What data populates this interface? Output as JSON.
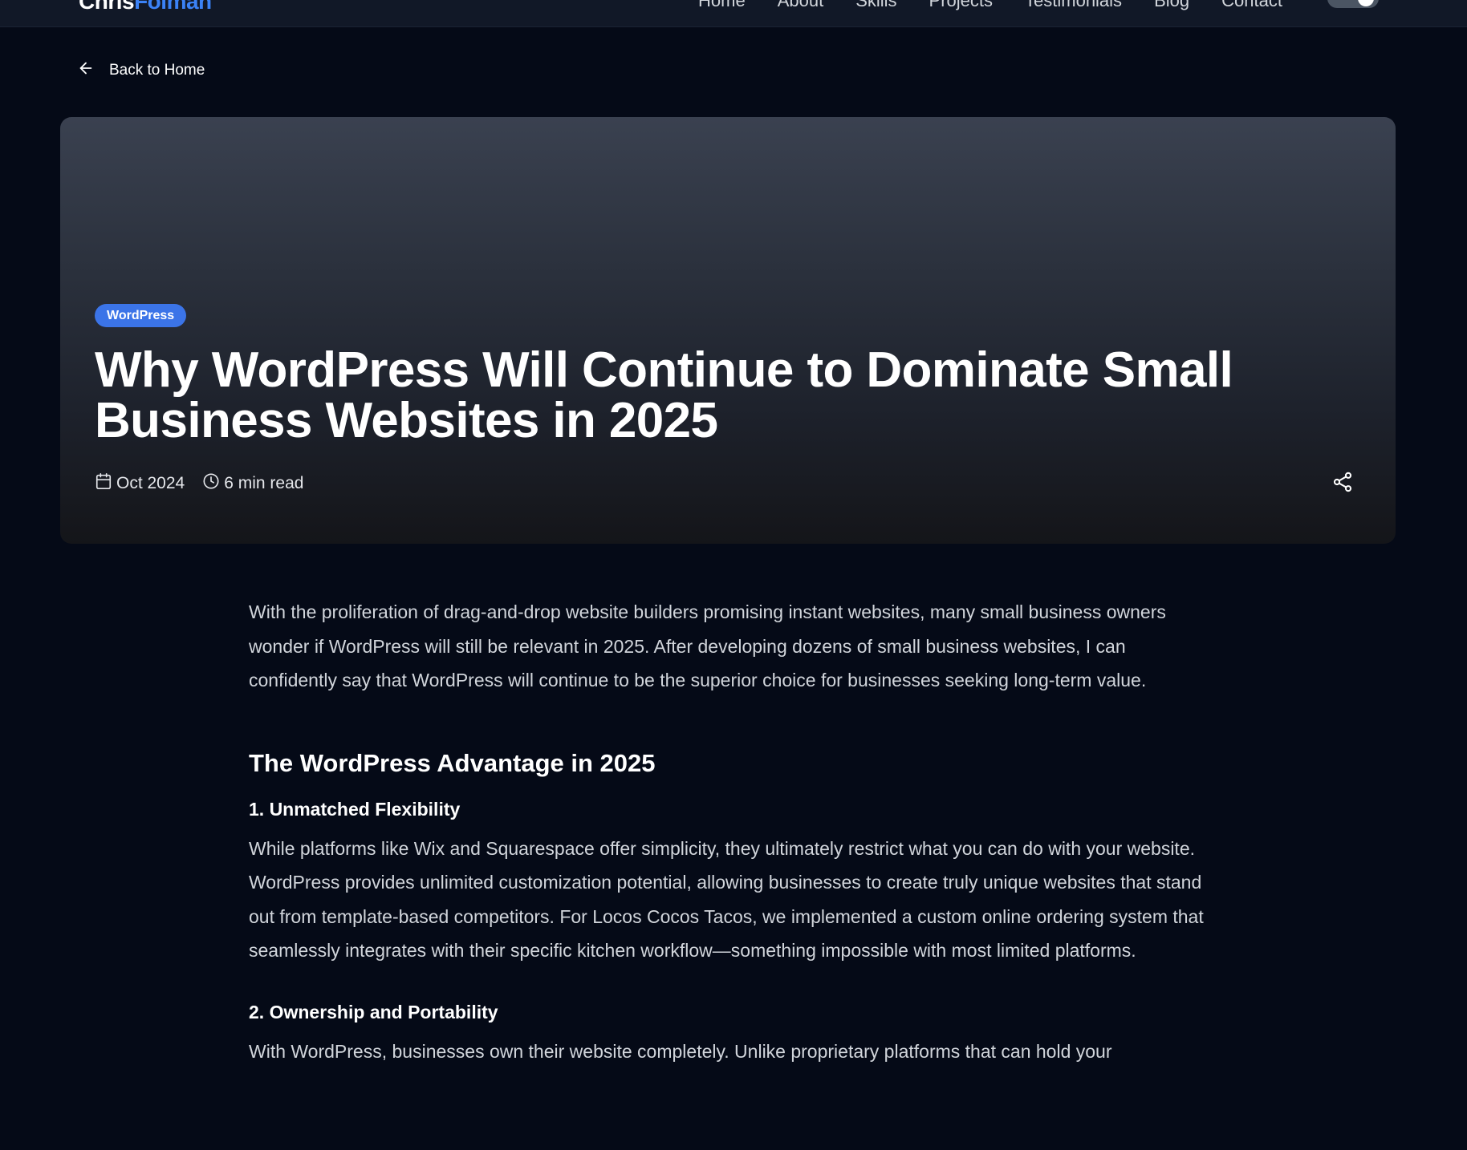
{
  "nav": {
    "logo_first": "Chris",
    "logo_last": "Folman",
    "links": [
      "Home",
      "About",
      "Skills",
      "Projects",
      "Testimonials",
      "Blog",
      "Contact"
    ]
  },
  "back_link": {
    "label": "Back to Home",
    "icon": "arrow-left-icon"
  },
  "post": {
    "category": "WordPress",
    "title": "Why WordPress Will Continue to Dominate Small Business Websites in 2025",
    "date": "Oct 2024",
    "read_time": "6 min read",
    "icons": {
      "date": "calendar-icon",
      "read_time": "clock-icon",
      "share": "share-icon"
    }
  },
  "article": {
    "intro": "With the proliferation of drag-and-drop website builders promising instant websites, many small business owners wonder if WordPress will still be relevant in 2025. After developing dozens of small business websites, I can confidently say that WordPress will continue to be the superior choice for businesses seeking long-term value.",
    "section_heading": "The WordPress Advantage in 2025",
    "point1_heading": "1. Unmatched Flexibility",
    "point1_text": "While platforms like Wix and Squarespace offer simplicity, they ultimately restrict what you can do with your website. WordPress provides unlimited customization potential, allowing businesses to create truly unique websites that stand out from template-based competitors. For Locos Cocos Tacos, we implemented a custom online ordering system that seamlessly integrates with their specific kitchen workflow—something impossible with most limited platforms.",
    "point2_heading": "2. Ownership and Portability",
    "point2_text": "With WordPress, businesses own their website completely. Unlike proprietary platforms that can hold your"
  },
  "colors": {
    "background": "#050a17",
    "nav_background": "#111827",
    "accent": "#3b82f6",
    "badge": "#3b74e8"
  }
}
